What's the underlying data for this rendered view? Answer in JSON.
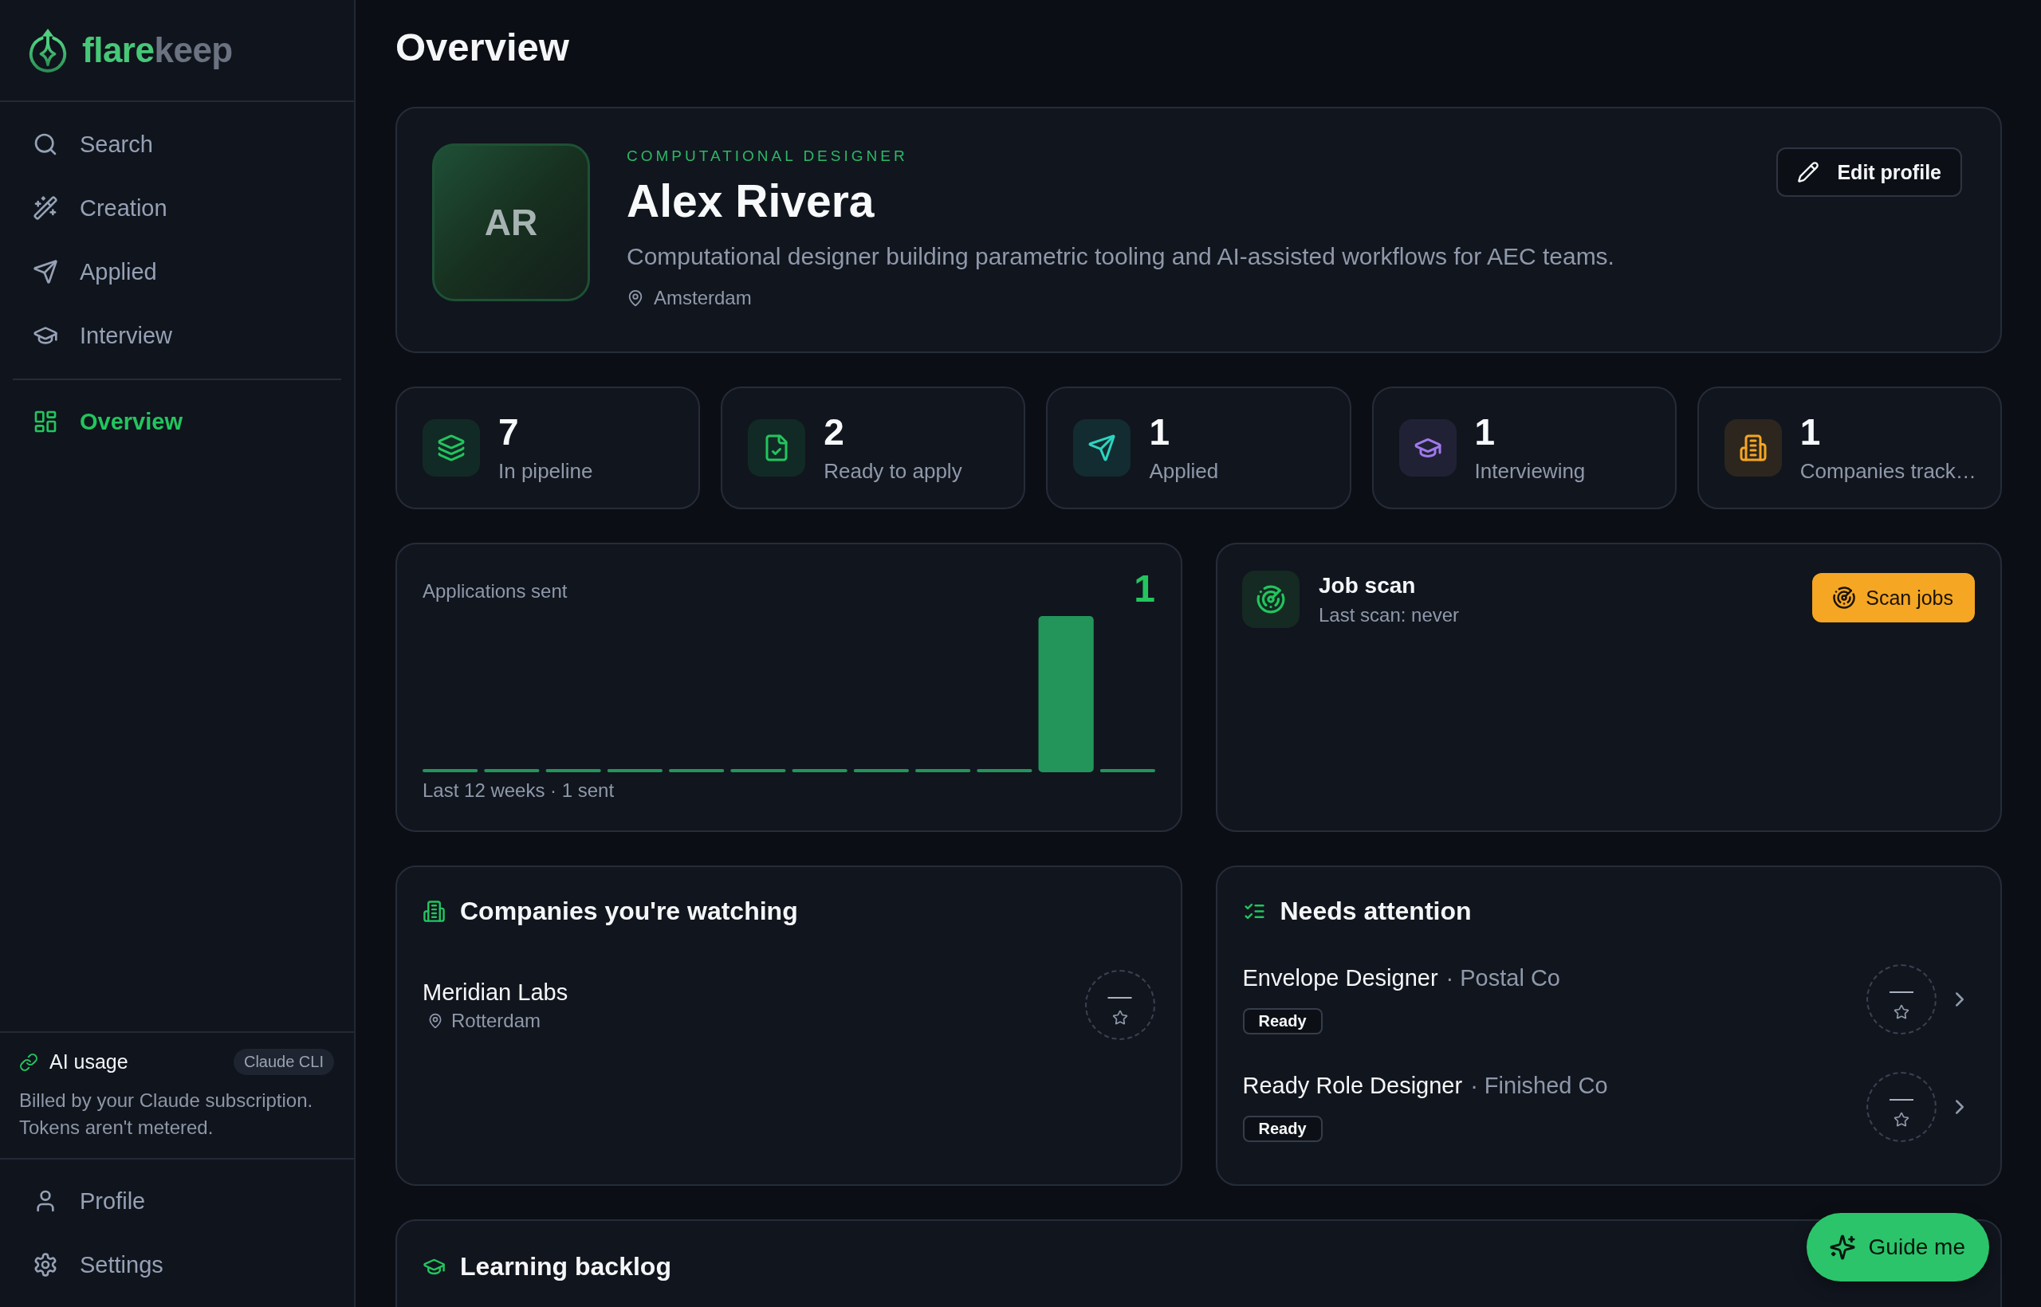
{
  "sidebar": {
    "brand": {
      "lead": "flare",
      "tail": "keep"
    },
    "nav": [
      {
        "label": "Search",
        "selected": false
      },
      {
        "label": "Creation",
        "selected": false
      },
      {
        "label": "Applied",
        "selected": false
      },
      {
        "label": "Interview",
        "selected": false
      }
    ],
    "nav_secondary": [
      {
        "label": "Overview",
        "selected": true
      }
    ],
    "ai_usage": {
      "title": "AI usage",
      "badge": "Claude CLI",
      "note": "Billed by your Claude subscription. Tokens aren't metered."
    },
    "footer_nav": [
      {
        "label": "Profile",
        "selected": false
      },
      {
        "label": "Settings",
        "selected": false
      }
    ]
  },
  "page_title": "Overview",
  "profile": {
    "initials": "AR",
    "headline": "COMPUTATIONAL DESIGNER",
    "name": "Alex Rivera",
    "bio": "Computational designer building parametric tooling and AI-assisted workflows for AEC teams.",
    "location": "Amsterdam",
    "edit_button": "Edit profile"
  },
  "stats": [
    {
      "value": "7",
      "label": "In pipeline",
      "color": "#22c55e"
    },
    {
      "value": "2",
      "label": "Ready to apply",
      "color": "#22c55e"
    },
    {
      "value": "1",
      "label": "Applied",
      "color": "#2dd4bf"
    },
    {
      "value": "1",
      "label": "Interviewing",
      "color": "#9f7aea"
    },
    {
      "value": "1",
      "label": "Companies track…",
      "color": "#f5a524"
    }
  ],
  "applications": {
    "title": "Applications sent",
    "total": "1",
    "caption": "Last 12 weeks · 1 sent"
  },
  "job_scan": {
    "title": "Job scan",
    "status": "Last scan: never",
    "button": "Scan jobs"
  },
  "companies": {
    "title": "Companies you're watching",
    "items": [
      {
        "name": "Meridian Labs",
        "location": "Rotterdam",
        "score": "—"
      }
    ]
  },
  "needs_attention": {
    "title": "Needs attention",
    "items": [
      {
        "title": "Envelope Designer",
        "subtitle": "· Postal Co",
        "status": "Ready",
        "score": "—"
      },
      {
        "title": "Ready Role Designer",
        "subtitle": "· Finished Co",
        "status": "Ready",
        "score": "—"
      }
    ]
  },
  "learning_backlog": {
    "title": "Learning backlog"
  },
  "guide_button": {
    "label": "Guide me"
  }
}
